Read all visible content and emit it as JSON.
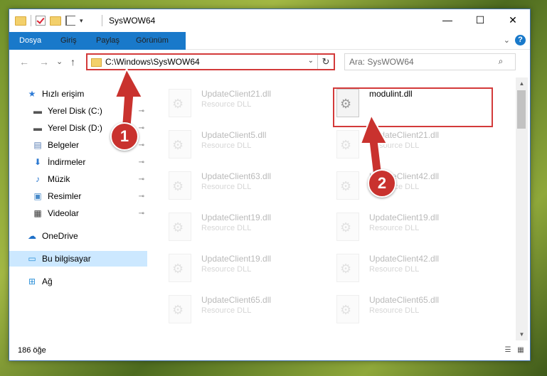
{
  "window": {
    "title": "SysWOW64",
    "minimize": "—",
    "maximize": "☐",
    "close": "✕"
  },
  "quick_access_toolbar": {
    "dropdown": "▾"
  },
  "ribbon": {
    "tabs": [
      "Dosya",
      "Giriş",
      "Paylaş",
      "Görünüm"
    ],
    "expand": "⌄",
    "help": "?"
  },
  "nav": {
    "back": "←",
    "forward": "→",
    "recent": "⌄",
    "up": "↑",
    "address": "C:\\Windows\\SysWOW64",
    "address_dropdown": "⌄",
    "refresh": "↻",
    "search_placeholder": "Ara: SysWOW64",
    "search_icon": "⌕"
  },
  "sidebar": {
    "items": [
      {
        "label": "Hızlı erişim",
        "icon": "star-icon",
        "glyph": "★",
        "color": "#2e7bd6",
        "pinned": false
      },
      {
        "label": "Yerel Disk (C:)",
        "icon": "drive-icon",
        "glyph": "▬",
        "color": "#555555",
        "pinned": true
      },
      {
        "label": "Yerel Disk (D:)",
        "icon": "drive-icon",
        "glyph": "▬",
        "color": "#555555",
        "pinned": true
      },
      {
        "label": "Belgeler",
        "icon": "documents-icon",
        "glyph": "▤",
        "color": "#5a7fb5",
        "pinned": true
      },
      {
        "label": "İndirmeler",
        "icon": "download-icon",
        "glyph": "⬇",
        "color": "#2b78d0",
        "pinned": true
      },
      {
        "label": "Müzik",
        "icon": "music-icon",
        "glyph": "♪",
        "color": "#2b78d0",
        "pinned": true
      },
      {
        "label": "Resimler",
        "icon": "pictures-icon",
        "glyph": "▣",
        "color": "#4a8bc9",
        "pinned": true
      },
      {
        "label": "Videolar",
        "icon": "videos-icon",
        "glyph": "▦",
        "color": "#333333",
        "pinned": true
      },
      {
        "label": "OneDrive",
        "icon": "cloud-icon",
        "glyph": "☁",
        "color": "#1e6fc7",
        "pinned": false
      },
      {
        "label": "Bu bilgisayar",
        "icon": "computer-icon",
        "glyph": "▭",
        "color": "#2a8fd8",
        "pinned": false,
        "selected": true
      },
      {
        "label": "Ağ",
        "icon": "network-icon",
        "glyph": "⊞",
        "color": "#2a8fd8",
        "pinned": false
      }
    ],
    "pin_glyph": "📌"
  },
  "files": [
    {
      "name": "UpdateClient21.dll",
      "type": "Resource DLL",
      "faded": true
    },
    {
      "name": "modulint.dll",
      "type": "",
      "faded": false
    },
    {
      "name": "UpdateClient5.dll",
      "type": "Resource DLL",
      "faded": true
    },
    {
      "name": "UpdateClient21.dll",
      "type": "Resource DLL",
      "faded": true
    },
    {
      "name": "UpdateClient63.dll",
      "type": "Resource DLL",
      "faded": true
    },
    {
      "name": "UpdateClient42.dll",
      "type": "Resource DLL",
      "faded": true
    },
    {
      "name": "UpdateClient19.dll",
      "type": "Resource DLL",
      "faded": true
    },
    {
      "name": "UpdateClient19.dll",
      "type": "Resource DLL",
      "faded": true
    },
    {
      "name": "UpdateClient19.dll",
      "type": "Resource DLL",
      "faded": true
    },
    {
      "name": "UpdateClient42.dll",
      "type": "Resource DLL",
      "faded": true
    },
    {
      "name": "UpdateClient65.dll",
      "type": "Resource DLL",
      "faded": true
    },
    {
      "name": "UpdateClient65.dll",
      "type": "Resource DLL",
      "faded": true
    }
  ],
  "scrollbar": {
    "up": "▲",
    "down": "▼"
  },
  "status": {
    "count": "186 öğe",
    "details_view": "☰",
    "tiles_view": "▦"
  },
  "annotations": {
    "step1": "1",
    "step2": "2",
    "color": "#c9322e"
  }
}
